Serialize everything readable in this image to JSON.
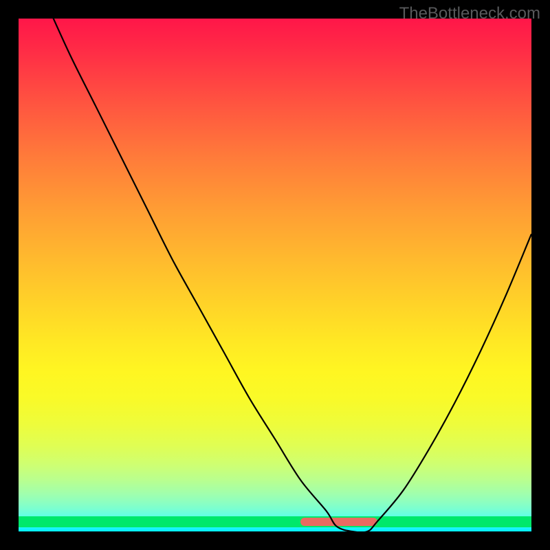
{
  "watermark": "TheBottleneck.com",
  "chart_data": {
    "type": "line",
    "title": "",
    "xlabel": "",
    "ylabel": "",
    "xlim": [
      0,
      100
    ],
    "ylim": [
      0,
      100
    ],
    "background_gradient": {
      "top": "#ff1649",
      "mid": "#fff622",
      "bottom": "#00f0ff"
    },
    "optimal_band": {
      "start_x": 55,
      "end_x": 70,
      "color": "#e96a62"
    },
    "series": [
      {
        "name": "bottleneck-curve",
        "x": [
          0,
          5,
          10,
          15,
          20,
          25,
          30,
          35,
          40,
          45,
          50,
          55,
          60,
          62,
          65,
          68,
          70,
          75,
          80,
          85,
          90,
          95,
          100
        ],
        "values": [
          115,
          104,
          93,
          83,
          73,
          63,
          53,
          44,
          35,
          26,
          18,
          10,
          4,
          1,
          0,
          0,
          2,
          8,
          16,
          25,
          35,
          46,
          58
        ]
      }
    ]
  }
}
